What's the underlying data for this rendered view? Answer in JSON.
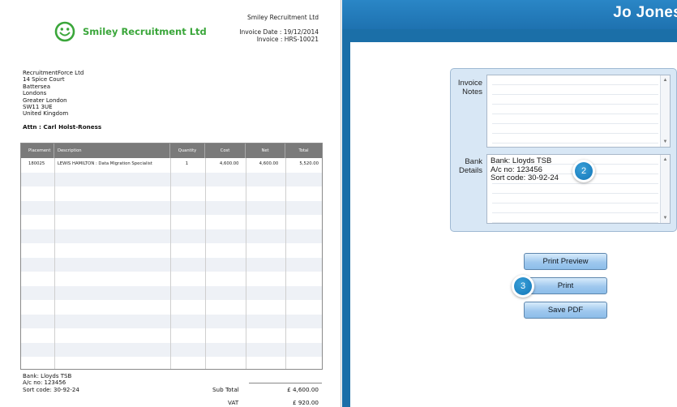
{
  "header": {
    "user_name": "Jo Jones"
  },
  "invoice_preview": {
    "logo_text": "Smiley Recruitment Ltd",
    "company_name": "Smiley Recruitment Ltd",
    "invoice_date": "Invoice Date : 19/12/2014",
    "invoice_number": "Invoice : HRS-10021",
    "address_lines": [
      "RecruitmentForce Ltd",
      "14 Spice Court",
      "Battersea",
      "Londons",
      "Greater London",
      "SW11 3UE",
      "United Kingdom"
    ],
    "attn": "Attn : Carl Holst-Roness",
    "table": {
      "columns": [
        "Placement",
        "Description",
        "Quantity",
        "Cost",
        "Net",
        "Total"
      ],
      "rows": [
        [
          "180025",
          "LEWIS HAMILTON : Data Migration Specialist",
          "1",
          "4,600.00",
          "4,600.00",
          "5,520.00"
        ]
      ]
    },
    "bank_lines": [
      "Bank:  Lloyds TSB",
      "A/c no:  123456",
      "Sort code:  30-92-24"
    ],
    "subtotal_label": "Sub Total",
    "subtotal_value": "£ 4,600.00",
    "vat_label": "VAT",
    "vat_value": "£ 920.00"
  },
  "form": {
    "invoice_notes_label_1": "Invoice",
    "invoice_notes_label_2": "Notes",
    "invoice_notes_value": "",
    "bank_details_label_1": "Bank",
    "bank_details_label_2": "Details",
    "bank_details_lines": [
      "Bank:  Lloyds TSB",
      "A/c no:  123456",
      "Sort code:  30-92-24"
    ]
  },
  "buttons": {
    "print_preview": "Print Preview",
    "print": "Print",
    "save_pdf": "Save PDF"
  },
  "callouts": {
    "bank_details_step": "2",
    "print_step": "3"
  },
  "colors": {
    "accent_blue": "#1b6fa8",
    "form_panel": "#d8e7f5",
    "logo_green": "#3aa63a",
    "callout_blue": "#1276b8"
  }
}
